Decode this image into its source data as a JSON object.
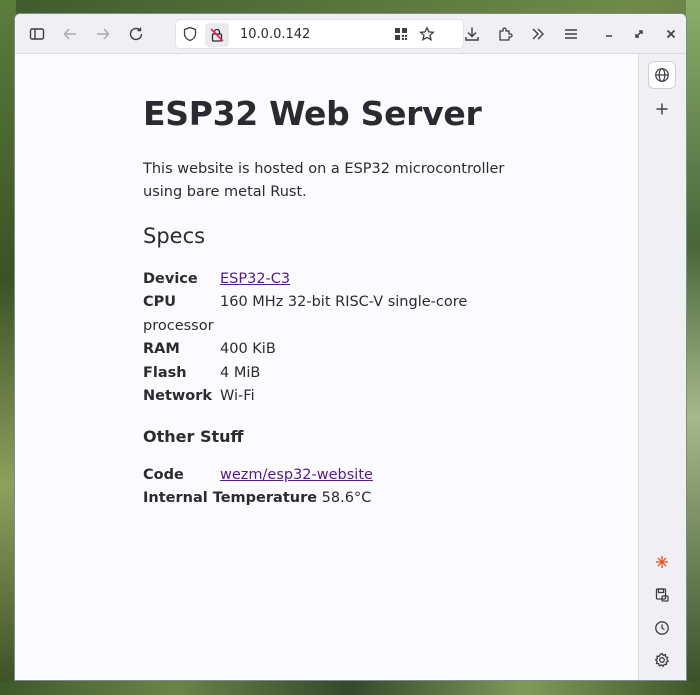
{
  "browser": {
    "url": "10.0.0.142"
  },
  "page": {
    "title": "ESP32 Web Server",
    "intro": "This website is hosted on a ESP32 microcontroller using bare metal Rust.",
    "specs_heading": "Specs",
    "specs": [
      {
        "label": "Device",
        "value": "ESP32-C3",
        "link": true
      },
      {
        "label": "CPU",
        "value": "160 MHz 32-bit RISC-V single-core",
        "continuation": "processor",
        "link": false
      },
      {
        "label": "RAM",
        "value": "400 KiB",
        "link": false
      },
      {
        "label": "Flash",
        "value": "4 MiB",
        "link": false
      },
      {
        "label": "Network",
        "value": "Wi-Fi",
        "link": false
      }
    ],
    "other_heading": "Other Stuff",
    "code_label": "Code",
    "code_value": "wezm/esp32-website",
    "temp_label": "Internal Temperature",
    "temp_value": "58.6°C"
  },
  "colors": {
    "link": "#551a8b",
    "text": "#2b2a33"
  }
}
